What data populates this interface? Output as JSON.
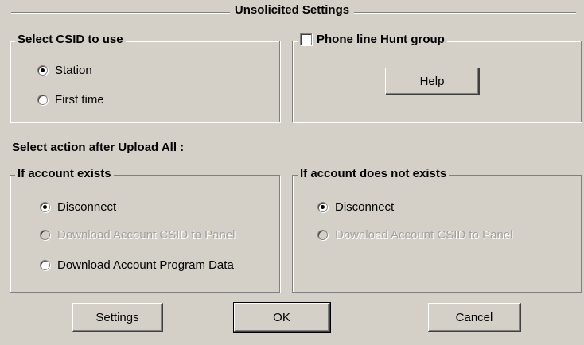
{
  "title": "Unsolicited Settings",
  "csid": {
    "legend": "Select CSID to use",
    "options": [
      {
        "label": "Station",
        "checked": true
      },
      {
        "label": "First time",
        "checked": false
      }
    ]
  },
  "hunt": {
    "label": "Phone line Hunt group",
    "checked": false,
    "help_label": "Help"
  },
  "upload_label": "Select action after Upload All :",
  "exists": {
    "legend": "If account exists",
    "options": [
      {
        "label": "Disconnect",
        "checked": true,
        "enabled": true
      },
      {
        "label": "Download Account CSID to Panel",
        "checked": false,
        "enabled": false
      },
      {
        "label": "Download Account Program Data",
        "checked": false,
        "enabled": true
      }
    ]
  },
  "not_exists": {
    "legend": "If account does not exists",
    "options": [
      {
        "label": "Disconnect",
        "checked": true,
        "enabled": true
      },
      {
        "label": "Download Account CSID to Panel",
        "checked": false,
        "enabled": false
      }
    ]
  },
  "buttons": {
    "settings": "Settings",
    "ok": "OK",
    "cancel": "Cancel"
  }
}
